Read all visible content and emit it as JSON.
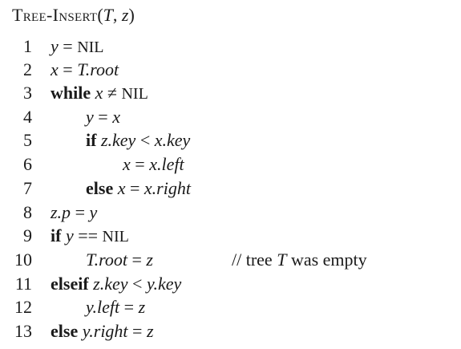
{
  "procedure": {
    "name": "Tree-Insert",
    "params": "(T, z)",
    "p_open": "(",
    "p_T": "T",
    "p_sep": ", ",
    "p_z": "z",
    "p_close": ")"
  },
  "lines": [
    {
      "num": "1",
      "tokens": {
        "a": "y",
        "b": " = ",
        "c": "NIL"
      }
    },
    {
      "num": "2",
      "tokens": {
        "a": "x",
        "b": " = ",
        "c": "T.root"
      }
    },
    {
      "num": "3",
      "tokens": {
        "kw": "while",
        "a": " x",
        "b": " ≠ ",
        "c": "NIL"
      }
    },
    {
      "num": "4",
      "tokens": {
        "a": "y",
        "b": " = ",
        "c": "x"
      }
    },
    {
      "num": "5",
      "tokens": {
        "kw": "if",
        "a": " z.key",
        "b": " < ",
        "c": "x.key"
      }
    },
    {
      "num": "6",
      "tokens": {
        "a": "x",
        "b": " = ",
        "c": "x.left"
      }
    },
    {
      "num": "7",
      "tokens": {
        "kw": "else",
        "a": " x",
        "b": " = ",
        "c": "x.right"
      }
    },
    {
      "num": "8",
      "tokens": {
        "a": "z.p",
        "b": " = ",
        "c": "y"
      }
    },
    {
      "num": "9",
      "tokens": {
        "kw": "if",
        "a": " y",
        "b": " == ",
        "c": "NIL"
      }
    },
    {
      "num": "10",
      "tokens": {
        "a": "T.root",
        "b": " = ",
        "c": "z"
      },
      "comment": {
        "prefix": "// tree ",
        "var": "T",
        "suffix": " was empty"
      }
    },
    {
      "num": "11",
      "tokens": {
        "kw": "elseif",
        "a": " z.key",
        "b": " < ",
        "c": "y.key"
      }
    },
    {
      "num": "12",
      "tokens": {
        "a": "y.left",
        "b": " = ",
        "c": "z"
      }
    },
    {
      "num": "13",
      "tokens": {
        "kw": "else",
        "a": " y.right",
        "b": " = ",
        "c": "z"
      }
    }
  ]
}
